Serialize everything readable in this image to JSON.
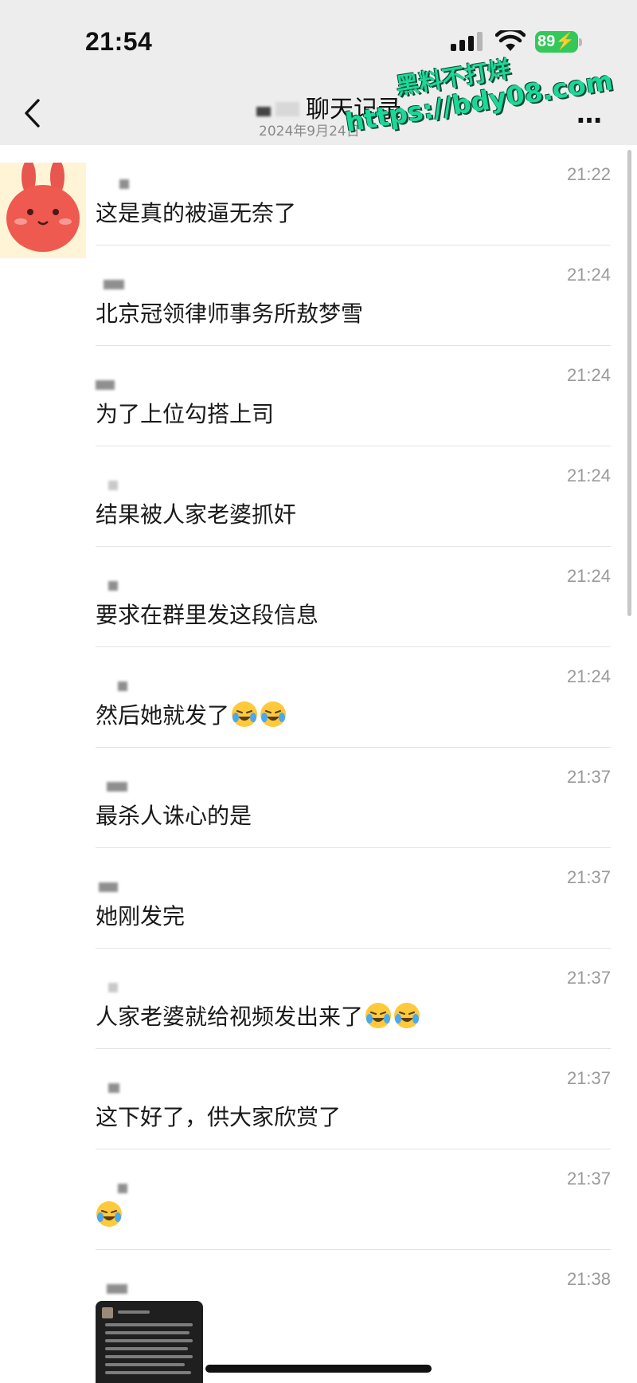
{
  "status_bar": {
    "time": "21:54",
    "battery": "89",
    "icons": [
      "signal-icon",
      "wifi-icon",
      "battery-icon"
    ]
  },
  "nav_bar": {
    "title": "聊天记录",
    "subtitle": "2024年9月24日",
    "icons": [
      "back-icon",
      "more-icon"
    ]
  },
  "watermark": {
    "line1": "黑料不打烊",
    "line2": "https://bdy08.com"
  },
  "messages": [
    {
      "text": "这是真的被逼无奈了",
      "time": "21:22",
      "emoji_count": 0
    },
    {
      "text": "北京冠领律师事务所敖梦雪",
      "time": "21:24",
      "emoji_count": 0
    },
    {
      "text": "为了上位勾搭上司",
      "time": "21:24",
      "emoji_count": 0
    },
    {
      "text": "结果被人家老婆抓奸",
      "time": "21:24",
      "emoji_count": 0
    },
    {
      "text": "要求在群里发这段信息",
      "time": "21:24",
      "emoji_count": 0
    },
    {
      "text": "然后她就发了",
      "time": "21:24",
      "emoji_count": 2
    },
    {
      "text": "最杀人诛心的是",
      "time": "21:37",
      "emoji_count": 0
    },
    {
      "text": "她刚发完",
      "time": "21:37",
      "emoji_count": 0
    },
    {
      "text": "人家老婆就给视频发出来了",
      "time": "21:37",
      "emoji_count": 2
    },
    {
      "text": "这下好了，供大家欣赏了",
      "time": "21:37",
      "emoji_count": 0
    },
    {
      "text": "",
      "time": "21:37",
      "emoji_count": 1
    },
    {
      "text": "",
      "time": "21:38",
      "emoji_count": 0
    }
  ],
  "colors": {
    "header_bg": "#ededed",
    "battery": "#34c759",
    "watermark": "#1bd89a",
    "time_text": "#9a9a9a"
  }
}
